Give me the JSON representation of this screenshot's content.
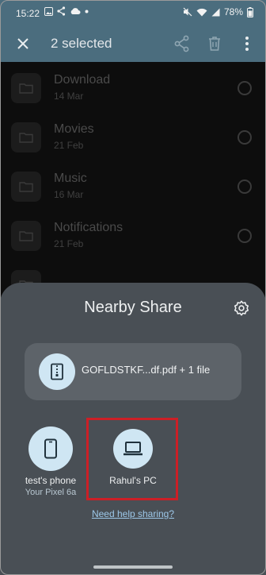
{
  "status_bar": {
    "time": "15:22",
    "battery": "78%",
    "left_icons": [
      "image-icon",
      "share-icon",
      "cloud-icon",
      "dot-icon"
    ],
    "right_icons": [
      "mute-icon",
      "wifi-icon",
      "signal-icon",
      "battery-icon"
    ]
  },
  "toolbar": {
    "title": "2 selected",
    "actions": [
      "share",
      "delete",
      "more"
    ]
  },
  "file_list": [
    {
      "name": "Download",
      "date": "14 Mar"
    },
    {
      "name": "Movies",
      "date": "21 Feb"
    },
    {
      "name": "Music",
      "date": "16 Mar"
    },
    {
      "name": "Notifications",
      "date": "21 Feb"
    }
  ],
  "sheet": {
    "title": "Nearby Share",
    "file_summary": "GOFLDSTKF...df.pdf + 1 file",
    "devices": [
      {
        "label": "test's phone",
        "sub": "Your Pixel 6a",
        "icon": "phone-icon"
      },
      {
        "label": "Rahul's PC",
        "sub": "",
        "icon": "laptop-icon"
      }
    ],
    "help_link": "Need help sharing?"
  },
  "colors": {
    "toolbar": "#4b6d7e",
    "sheet": "#494f55",
    "accent_circle": "#cfe6f3",
    "highlight": "#cc1f26",
    "link": "#9cc7e8"
  }
}
